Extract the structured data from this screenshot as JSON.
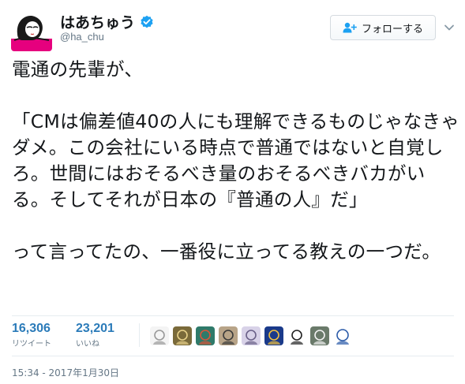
{
  "author": {
    "display_name": "はあちゅう",
    "handle": "@ha_chu",
    "verified": true
  },
  "follow_button": {
    "label": "フォローする",
    "icon": "add-user-icon"
  },
  "more_menu": {
    "icon": "chevron-down-icon"
  },
  "tweet": {
    "text": "電通の先輩が、\n\n「CMは偏差値40の人にも理解できるものじゃなきゃダメ。この会社にいる時点で普通ではないと自覚しろ。世間にはおそるべき量のおそるべきバカがいる。そしてそれが日本の『普通の人』だ」\n\nって言ってたの、一番役に立ってる教えの一つだ。"
  },
  "stats": {
    "retweets": {
      "count": "16,306",
      "label": "リツイート"
    },
    "likes": {
      "count": "23,201",
      "label": "いいね"
    }
  },
  "likers": [
    {
      "icon": "sketch-avatar",
      "bg": "#f4f4f4",
      "fg": "#999999"
    },
    {
      "icon": "scene-avatar",
      "bg": "#7a6a3a",
      "fg": "#e8d28a"
    },
    {
      "icon": "dragon-avatar",
      "bg": "#2f7a6a",
      "fg": "#d9553a"
    },
    {
      "icon": "anime-avatar",
      "bg": "#b8a488",
      "fg": "#3a3a3a"
    },
    {
      "icon": "anime-avatar",
      "bg": "#d8d2e8",
      "fg": "#6a6088"
    },
    {
      "icon": "sparkle-avatar",
      "bg": "#1a3a8a",
      "fg": "#f0c040"
    },
    {
      "icon": "boy-avatar",
      "bg": "#ffffff",
      "fg": "#222222"
    },
    {
      "icon": "joker-avatar",
      "bg": "#6a7a6a",
      "fg": "#f2f2f2"
    },
    {
      "icon": "logo-avatar",
      "bg": "#ffffff",
      "fg": "#2a5aa8"
    }
  ],
  "timestamp": "15:34 - 2017年1月30日",
  "colors": {
    "accent": "#1da1f2",
    "stat_link": "#2b7bb9",
    "avatar_pink": "#e6007e",
    "muted": "#657786"
  }
}
